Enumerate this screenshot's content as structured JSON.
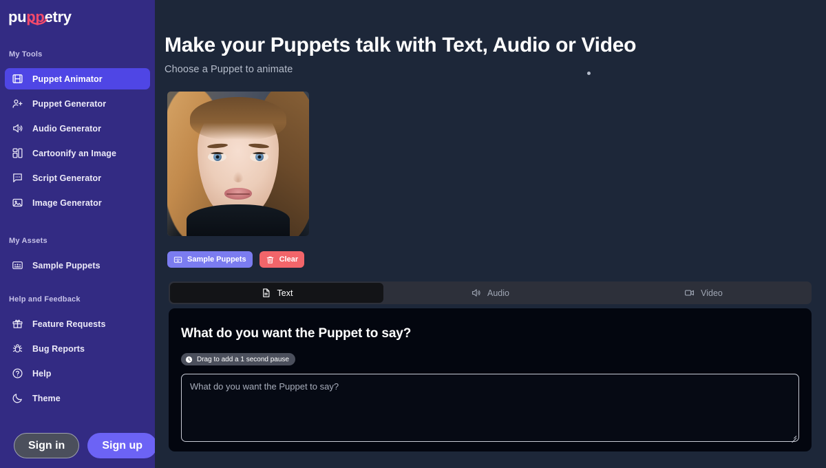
{
  "brand": {
    "name_pre": "pu",
    "name_mid": "pp",
    "name_post": "etry",
    "logo_icon": "puppetry-smile-logo"
  },
  "sidebar": {
    "sections": [
      {
        "label": "My Tools"
      },
      {
        "label": "My Assets"
      },
      {
        "label": "Help and Feedback"
      }
    ],
    "tools": [
      {
        "label": "Puppet Animator",
        "icon": "film-strip-icon",
        "active": true
      },
      {
        "label": "Puppet Generator",
        "icon": "user-plus-icon",
        "active": false
      },
      {
        "label": "Audio Generator",
        "icon": "speaker-wave-icon",
        "active": false
      },
      {
        "label": "Cartoonify an Image",
        "icon": "layout-dashboard-icon",
        "active": false
      },
      {
        "label": "Script Generator",
        "icon": "chat-bubble-icon",
        "active": false
      },
      {
        "label": "Image Generator",
        "icon": "image-icon",
        "active": false
      }
    ],
    "assets": [
      {
        "label": "Sample Puppets",
        "icon": "users-card-icon"
      }
    ],
    "help": [
      {
        "label": "Feature Requests",
        "icon": "gift-icon"
      },
      {
        "label": "Bug Reports",
        "icon": "bug-icon"
      },
      {
        "label": "Help",
        "icon": "question-circle-icon"
      },
      {
        "label": "Theme",
        "icon": "moon-icon"
      }
    ],
    "auth": {
      "sign_in": "Sign in",
      "sign_up": "Sign up"
    }
  },
  "main": {
    "title": "Make your Puppets talk with Text, Audio or Video",
    "subtitle": "Choose a Puppet to animate",
    "puppet_thumbnail": "female-portrait-puppet",
    "actions": [
      {
        "label": "Sample Puppets",
        "icon": "users-card-icon"
      },
      {
        "label": "Clear",
        "icon": "trash-icon"
      }
    ],
    "tabs": [
      {
        "label": "Text",
        "icon": "document-icon",
        "active": true
      },
      {
        "label": "Audio",
        "icon": "speaker-wave-icon",
        "active": false
      },
      {
        "label": "Video",
        "icon": "video-camera-icon",
        "active": false
      }
    ],
    "panel": {
      "heading": "What do you want the Puppet to say?",
      "pause_chip": {
        "label": "Drag to add a 1 second pause",
        "icon": "clock-icon"
      },
      "textarea": {
        "value": "",
        "placeholder": "What do you want the Puppet to say?"
      }
    }
  },
  "colors": {
    "sidebar_bg": "#332b83",
    "active_nav": "#4f46e5",
    "main_bg": "#1d2739",
    "panel_bg": "#03060f",
    "tabbar_bg": "#2d303a",
    "accent_pink": "#f2496b",
    "danger": "#f2656a",
    "sample_purple": "#7b7cf0"
  }
}
